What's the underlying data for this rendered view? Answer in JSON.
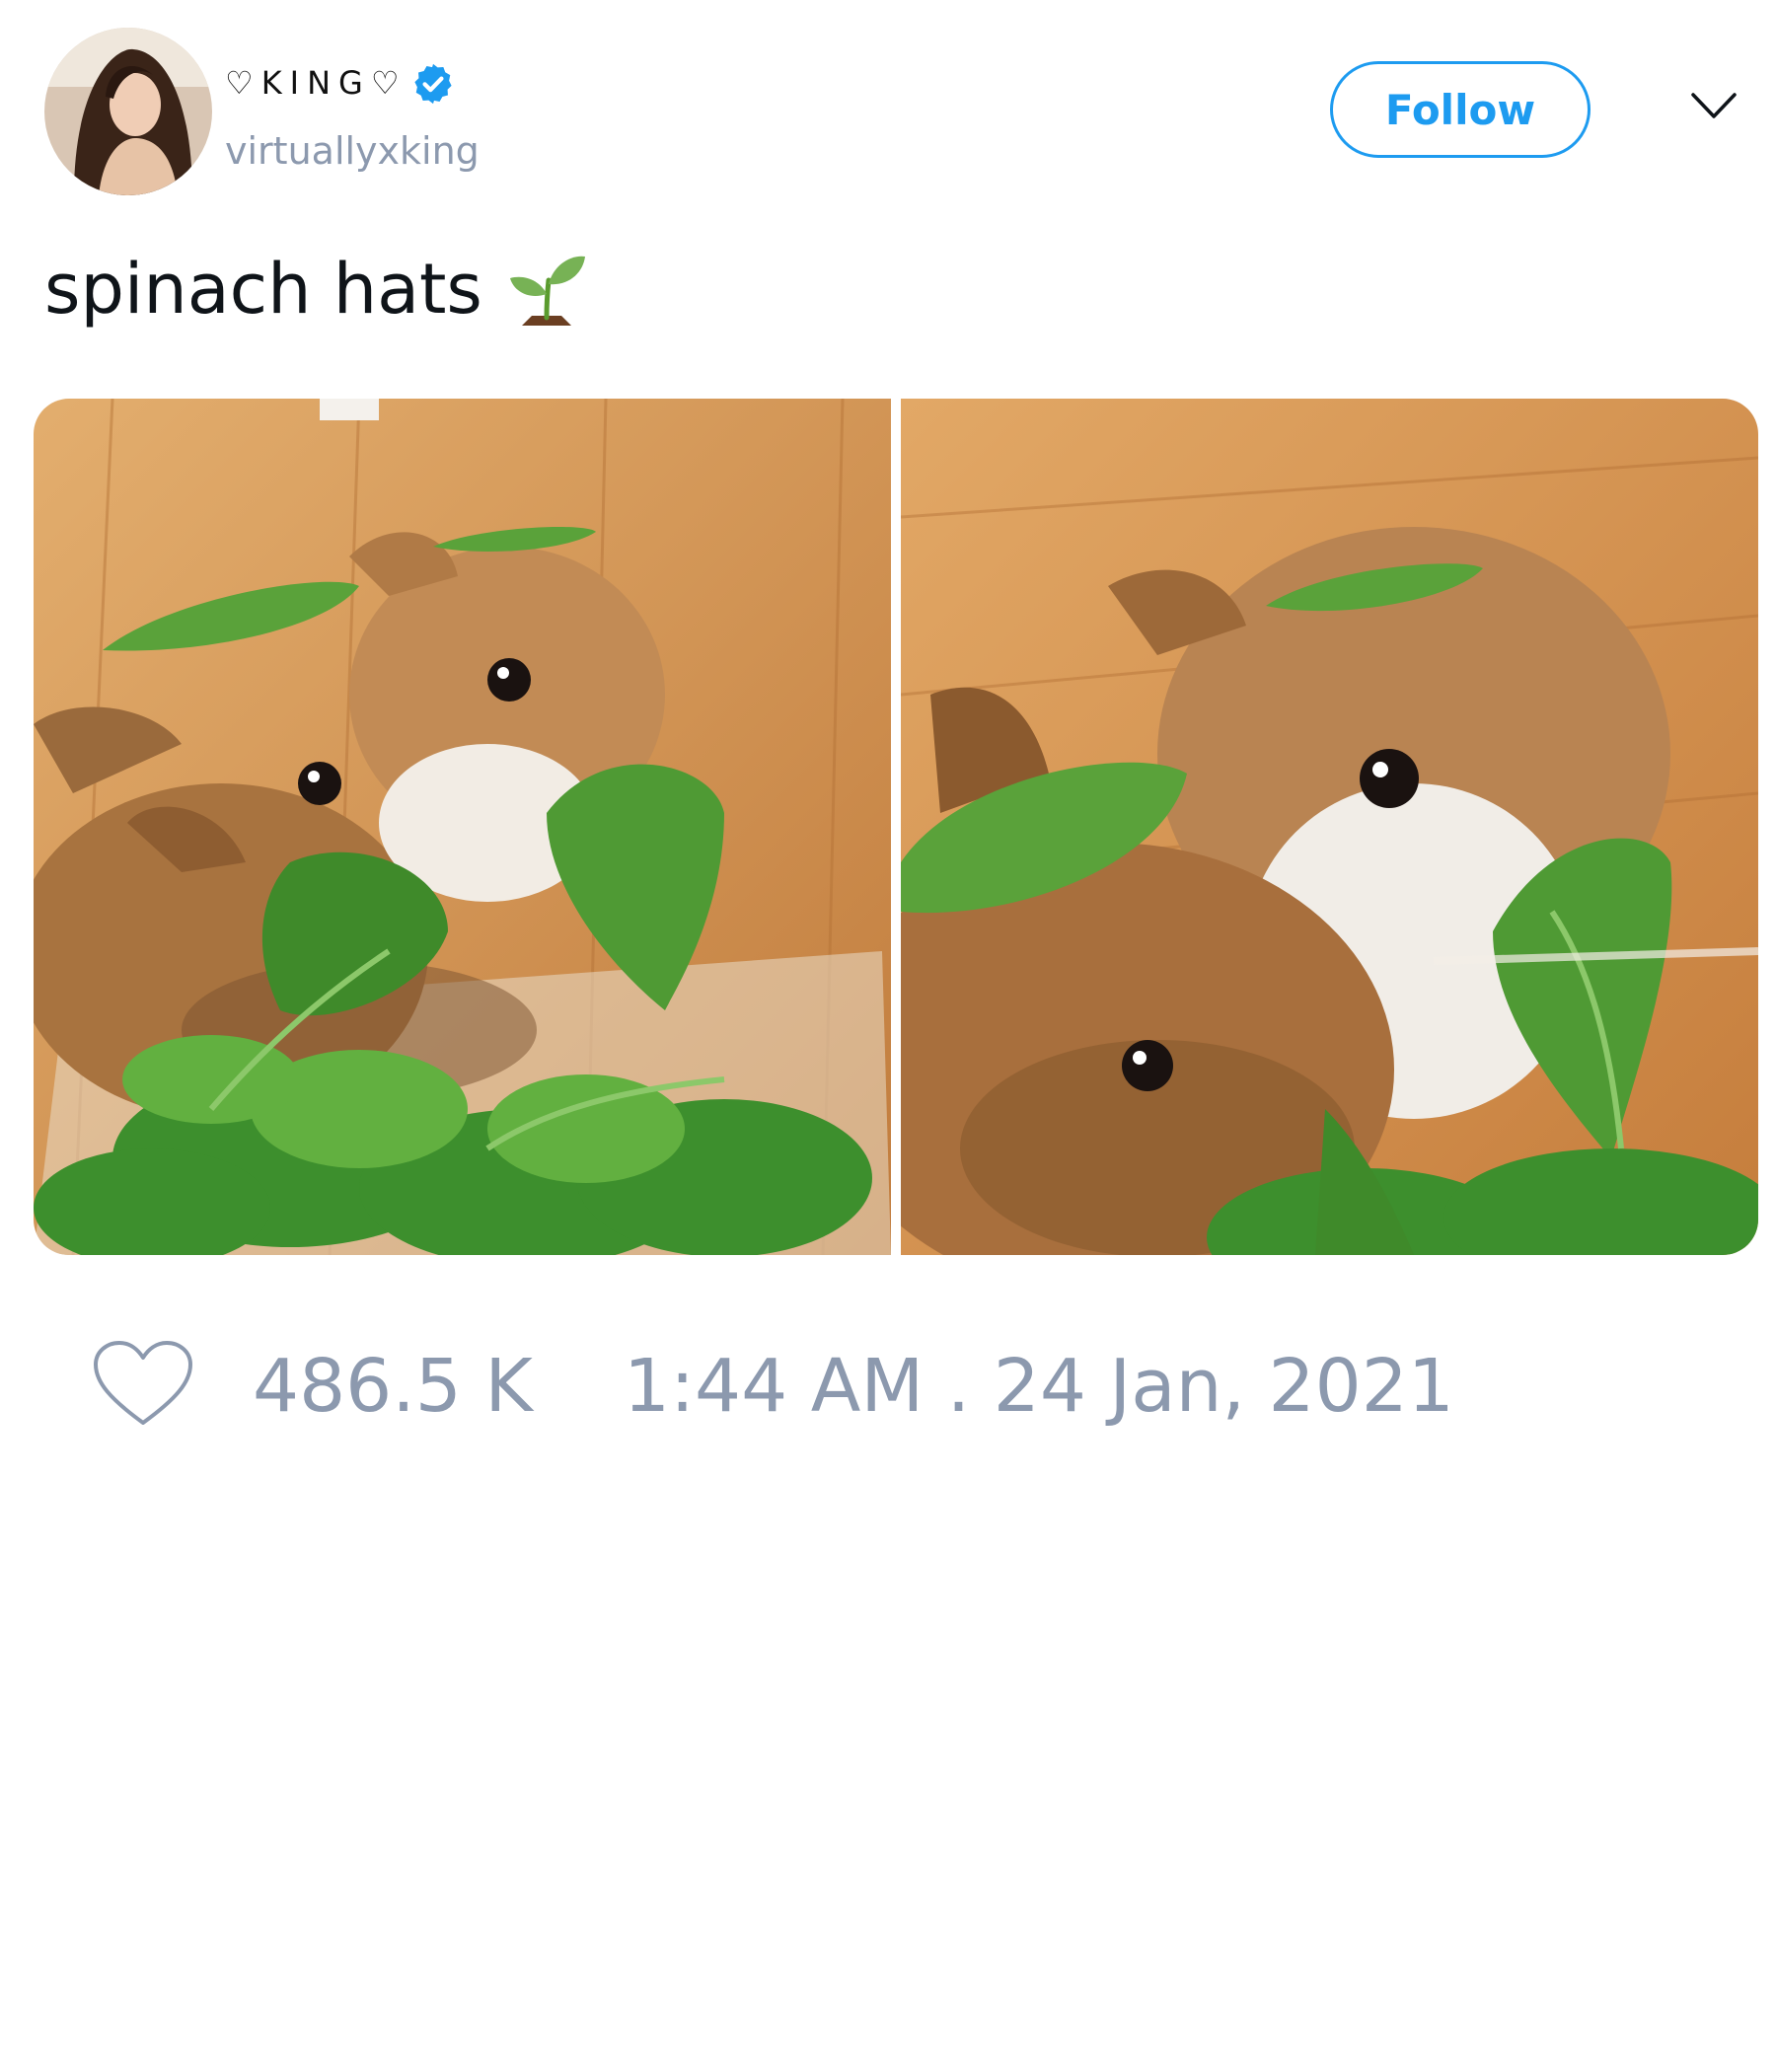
{
  "author": {
    "display_name": "♡KING♡",
    "username": "virtuallyxking",
    "verified": true,
    "avatar_icon": "profile-photo"
  },
  "header": {
    "follow_label": "Follow",
    "menu_icon": "chevron-down-icon"
  },
  "tweet": {
    "text": "spinach hats",
    "emoji_icon": "seedling-icon",
    "media": [
      {
        "description_icon": "photo-two-bunnies-spinach-left"
      },
      {
        "description_icon": "photo-two-bunnies-spinach-right"
      }
    ]
  },
  "footer": {
    "like_icon": "heart-icon",
    "like_count": "486.5 K",
    "timestamp": "1:44 AM . 24 Jan, 2021"
  },
  "colors": {
    "accent": "#1d9bf0",
    "muted_text": "#8c99ae",
    "text": "#0f1419",
    "background": "#ffffff"
  }
}
